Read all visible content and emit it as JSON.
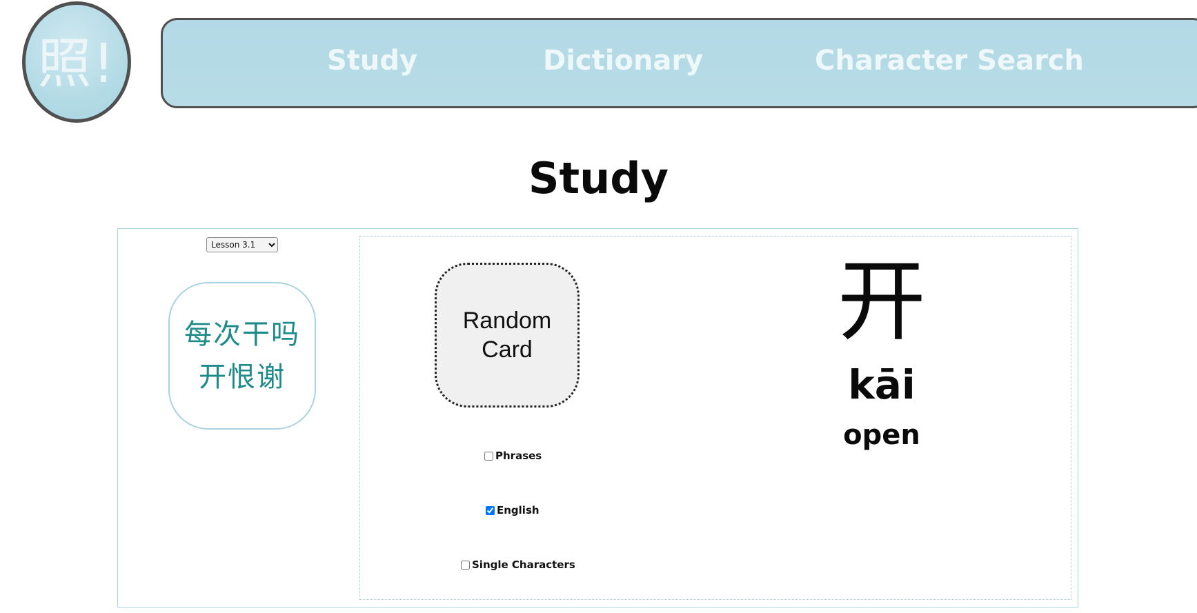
{
  "logo": {
    "text": "照!",
    "icon": "zhao-logo-icon"
  },
  "nav": {
    "items": [
      {
        "label": "Study"
      },
      {
        "label": "Dictionary"
      },
      {
        "label": "Character Search"
      }
    ]
  },
  "page": {
    "title": "Study"
  },
  "study": {
    "lesson_select": {
      "selected": "Lesson 3.1",
      "options": [
        "Lesson 3.1"
      ]
    },
    "characters": "每次干吗开恨谢",
    "random_card_label": "Random Card",
    "options": {
      "phrases": {
        "label": "Phrases",
        "checked": false
      },
      "english": {
        "label": "English",
        "checked": true
      },
      "single": {
        "label": "Single Characters",
        "checked": false
      }
    },
    "answer": {
      "character": "开",
      "pinyin": "kāi",
      "english": "open"
    }
  },
  "colors": {
    "nav_background": "#b2d9e5",
    "nav_text": "#eef7fa",
    "border_dark": "#505050",
    "char_list_text": "#1e8b8b",
    "panel_border": "#a8d6e0"
  }
}
